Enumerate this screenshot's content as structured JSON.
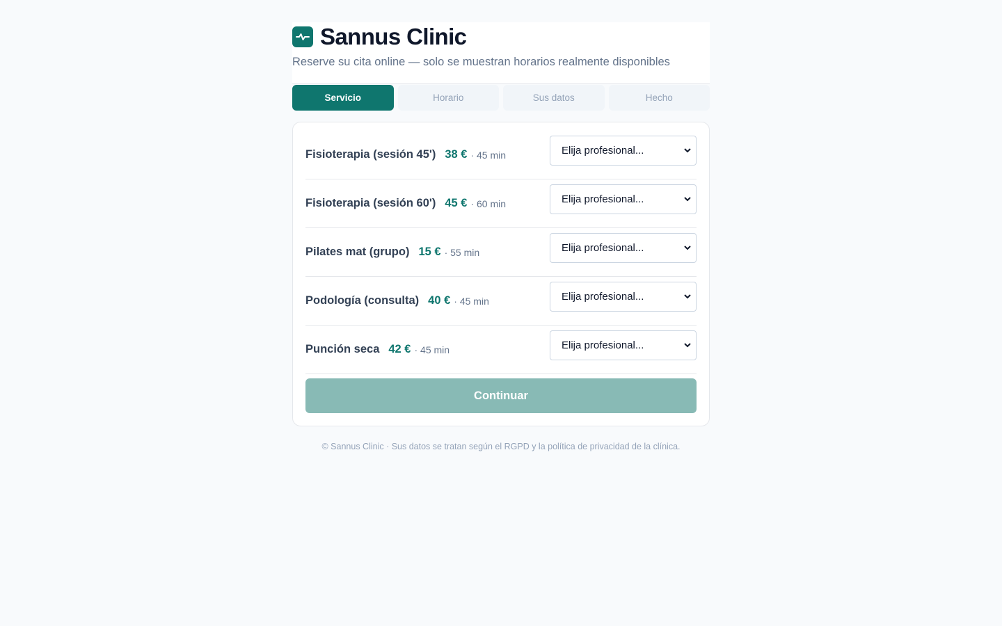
{
  "brand": {
    "name": "Sannus Clinic",
    "subtitle": "Reserve su cita online — solo se muestran horarios realmente disponibles",
    "logo_icon": "pulse-icon",
    "accent_color": "#0f766e"
  },
  "steps": [
    {
      "label": "Servicio",
      "active": true
    },
    {
      "label": "Horario",
      "active": false
    },
    {
      "label": "Sus datos",
      "active": false
    },
    {
      "label": "Hecho",
      "active": false
    }
  ],
  "services": [
    {
      "name": "Fisioterapia (sesión 45')",
      "price": "38 €",
      "duration": "· 45 min",
      "select_value": "Elija profesional..."
    },
    {
      "name": "Fisioterapia (sesión 60')",
      "price": "45 €",
      "duration": "· 60 min",
      "select_value": "Elija profesional..."
    },
    {
      "name": "Pilates mat (grupo)",
      "price": "15 €",
      "duration": "· 55 min",
      "select_value": "Elija profesional..."
    },
    {
      "name": "Podología (consulta)",
      "price": "40 €",
      "duration": "· 45 min",
      "select_value": "Elija profesional..."
    },
    {
      "name": "Punción seca",
      "price": "42 €",
      "duration": "· 45 min",
      "select_value": "Elija profesional..."
    }
  ],
  "continue_label": "Continuar",
  "footer": "© Sannus Clinic · Sus datos se tratan según el RGPD y la política de privacidad de la clínica."
}
